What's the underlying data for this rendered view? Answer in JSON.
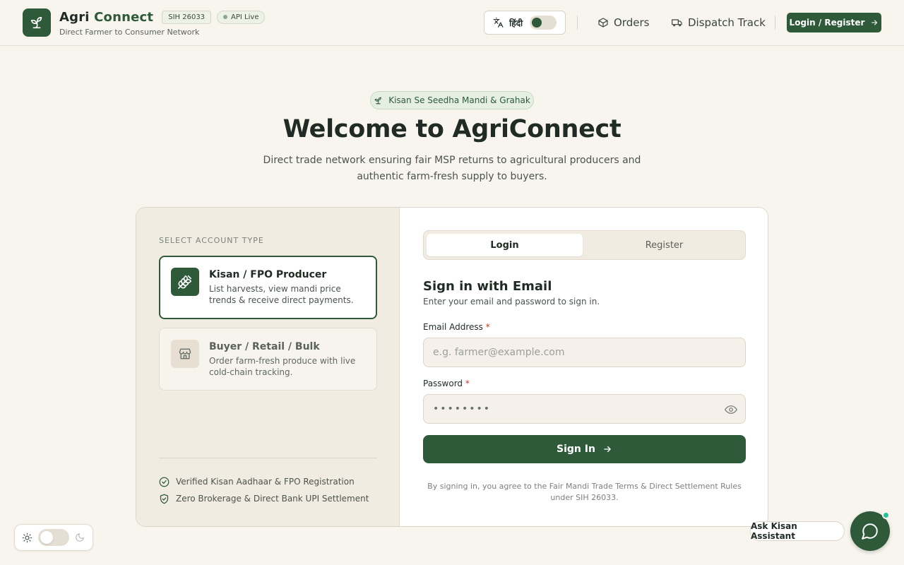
{
  "header": {
    "brand_part1": "Agri",
    "brand_part2": "Connect",
    "badge_sih": "SIH 26033",
    "badge_api": "API Live",
    "tagline": "Direct Farmer to Consumer Network",
    "language_label": "हिंदी",
    "nav_orders": "Orders",
    "nav_dispatch": "Dispatch Track",
    "login_button": "Login / Register"
  },
  "hero": {
    "pill": "Kisan Se Seedha Mandi & Grahak",
    "title": "Welcome to AgriConnect",
    "subtitle": "Direct trade network ensuring fair MSP returns to agricultural producers and authentic farm-fresh supply to buyers."
  },
  "account_type": {
    "label": "SELECT ACCOUNT TYPE",
    "options": [
      {
        "title": "Kisan / FPO Producer",
        "description": "List harvests, view mandi price trends & receive direct payments.",
        "icon": "wheat-icon",
        "selected": true
      },
      {
        "title": "Buyer / Retail / Bulk",
        "description": "Order farm-fresh produce with live cold-chain tracking.",
        "icon": "store-icon",
        "selected": false
      }
    ],
    "features": [
      "Verified Kisan Aadhaar & FPO Registration",
      "Zero Brokerage & Direct Bank UPI Settlement"
    ]
  },
  "auth": {
    "tabs": [
      {
        "label": "Login",
        "active": true
      },
      {
        "label": "Register",
        "active": false
      }
    ],
    "title": "Sign in with Email",
    "subtitle": "Enter your email and password to sign in.",
    "email_label": "Email Address",
    "email_placeholder": "e.g. farmer@example.com",
    "password_label": "Password",
    "password_value": "••••••••",
    "required_mark": "*",
    "signin_button": "Sign In",
    "terms": "By signing in, you agree to the Fair Mandi Trade Terms & Direct Settlement Rules under SIH 26033."
  },
  "assistant": {
    "label": "Ask Kisan Assistant"
  },
  "colors": {
    "primary": "#2e5a3a",
    "background": "#f8f5ef",
    "panel": "#f1ece2",
    "online": "#22c39a"
  }
}
